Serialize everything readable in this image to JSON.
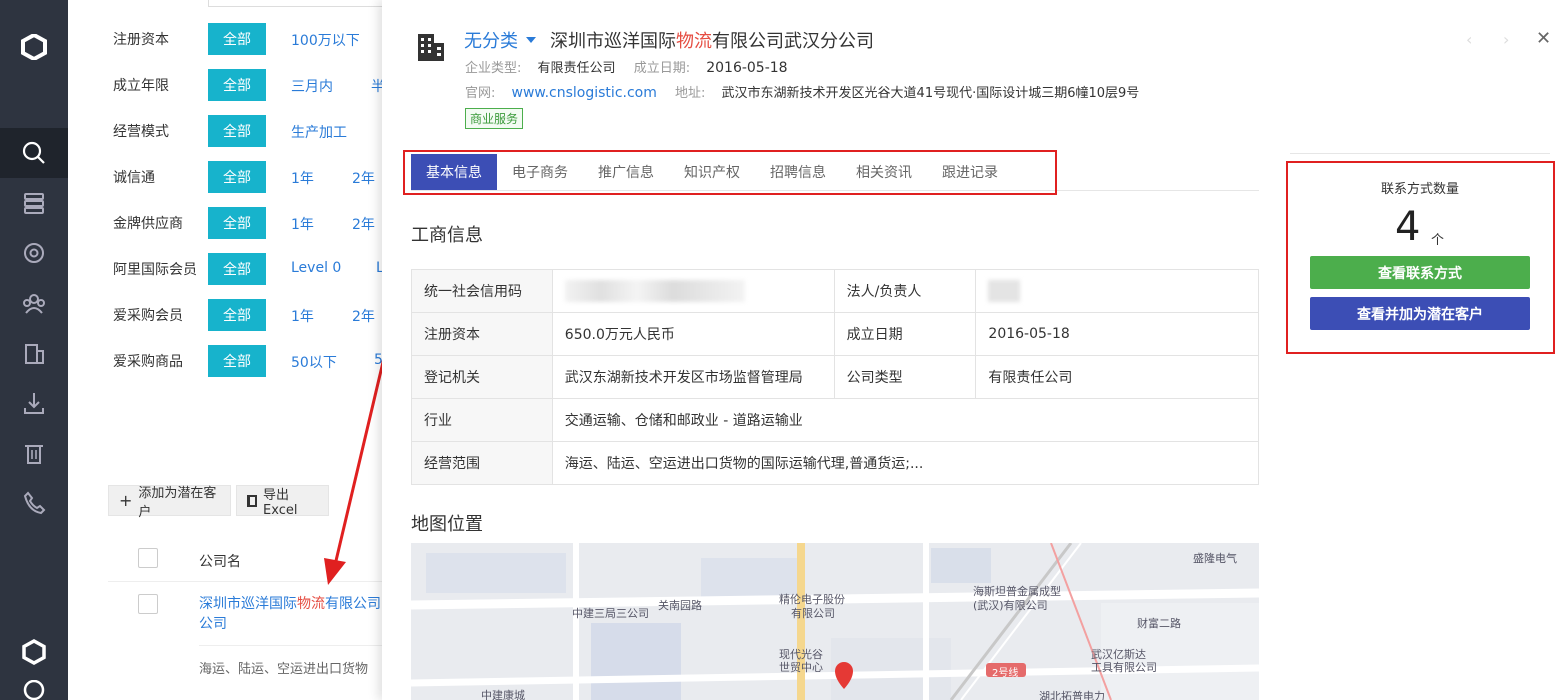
{
  "filters": {
    "rows": [
      {
        "label": "注册资本",
        "all": "全部",
        "opts": [
          "100万以下"
        ]
      },
      {
        "label": "成立年限",
        "all": "全部",
        "opts": [
          "三月内",
          "半"
        ]
      },
      {
        "label": "经营模式",
        "all": "全部",
        "opts": [
          "生产加工"
        ]
      },
      {
        "label": "诚信通",
        "all": "全部",
        "opts": [
          "1年",
          "2年"
        ]
      },
      {
        "label": "金牌供应商",
        "all": "全部",
        "opts": [
          "1年",
          "2年"
        ]
      },
      {
        "label": "阿里国际会员",
        "all": "全部",
        "opts": [
          "Level 0",
          "L"
        ]
      },
      {
        "label": "爱采购会员",
        "all": "全部",
        "opts": [
          "1年",
          "2年"
        ]
      },
      {
        "label": "爱采购商品",
        "all": "全部",
        "opts": [
          "50以下",
          "5"
        ]
      }
    ]
  },
  "toolbar": {
    "add_potential": "添加为潜在客户",
    "export_excel": "导出Excel"
  },
  "list": {
    "col_company": "公司名",
    "row1": {
      "name_a": "深圳市巡洋国际",
      "name_hl": "物流",
      "name_b": "有限公司",
      "name_c": "公司",
      "scope": "海运、陆运、空运进出口货物"
    }
  },
  "drawer": {
    "category": "无分类",
    "title_a": "深圳市巡洋国际",
    "title_hl": "物流",
    "title_b": "有限公司武汉分公司",
    "type_label": "企业类型:",
    "type_value": "有限责任公司",
    "est_label": "成立日期:",
    "est_value": "2016-05-18",
    "site_label": "官网:",
    "site_value": "www.cnslogistic.com",
    "addr_label": "地址:",
    "addr_value": "武汉市东湖新技术开发区光谷大道41号现代·国际设计城三期6幢10层9号",
    "tag": "商业服务",
    "tabs": [
      "基本信息",
      "电子商务",
      "推广信息",
      "知识产权",
      "招聘信息",
      "相关资讯",
      "跟进记录"
    ],
    "section_biz": "工商信息",
    "biz": {
      "credit_code_k": "统一社会信用码",
      "legal_k": "法人/负责人",
      "capital_k": "注册资本",
      "capital_v": "650.0万元人民币",
      "est_k": "成立日期",
      "est_v": "2016-05-18",
      "authority_k": "登记机关",
      "authority_v": "武汉东湖新技术开发区市场监督管理局",
      "ctype_k": "公司类型",
      "ctype_v": "有限责任公司",
      "industry_k": "行业",
      "industry_v": "交通运输、仓储和邮政业 - 道路运输业",
      "scope_k": "经营范围",
      "scope_v": "海运、陆运、空运进出口货物的国际运输代理,普通货运;..."
    },
    "section_map": "地图位置",
    "map_labels": [
      "盛隆电气",
      "海斯坦普金属成型",
      "(武汉)有限公司",
      "精伦电子股份",
      "有限公司",
      "中建三局三公司",
      "关南园路",
      "财富二路",
      "现代光谷",
      "世贸中心",
      "2号线",
      "武汉亿斯达",
      "工具有限公司",
      "中建康城",
      "湖北拓普电力"
    ],
    "contact": {
      "title": "联系方式数量",
      "count": "4",
      "unit": "个",
      "view_btn": "查看联系方式",
      "add_btn": "查看并加为潜在客户"
    }
  },
  "colors": {
    "accent_cyan": "#17b3cc",
    "link_blue": "#2a7bd8",
    "tab_indigo": "#3c4eb5",
    "green": "#4cae4c",
    "highlight_red": "#e54d42",
    "annotation_red": "#e02020"
  }
}
